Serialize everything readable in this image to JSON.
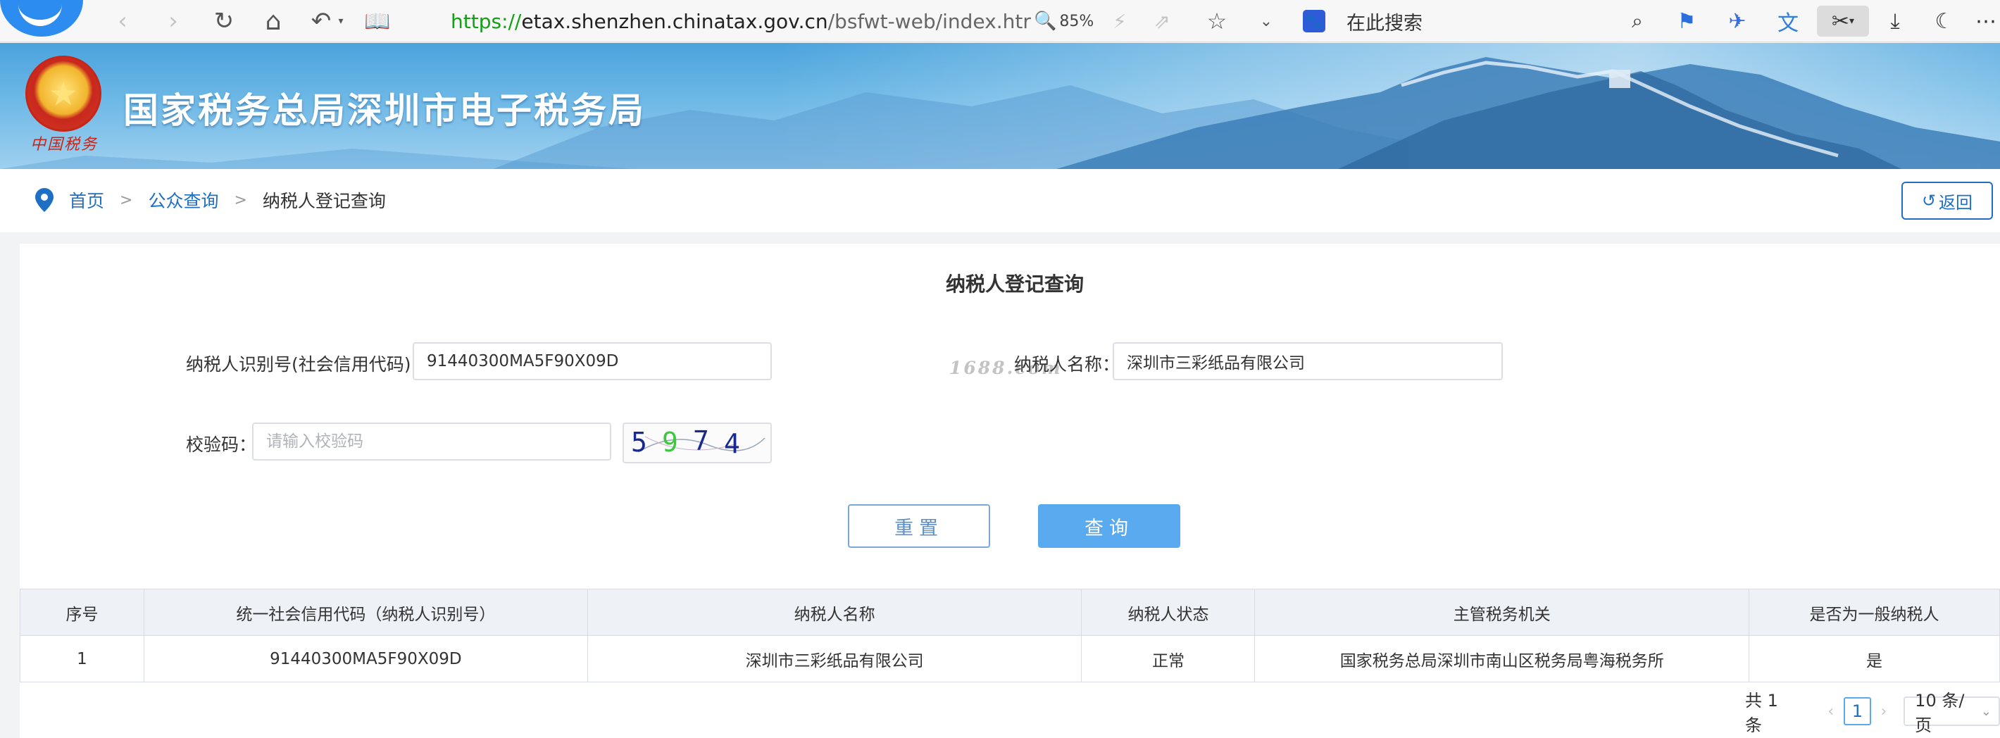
{
  "browser": {
    "url_scheme": "https://",
    "url_host": "etax.shenzhen.chinatax.gov.cn",
    "url_path": "/bsfwt-web/index.htr",
    "zoom": "85%",
    "search_placeholder": "在此搜索"
  },
  "site": {
    "title": "国家税务总局深圳市电子税务局",
    "emblem_script": "中国税务"
  },
  "breadcrumb": {
    "home": "首页",
    "public_query": "公众查询",
    "current": "纳税人登记查询",
    "separator": ">"
  },
  "back_button": "返回",
  "form": {
    "title": "纳税人登记查询",
    "taxpayer_id_label": "纳税人识别号(社会信用代码)：",
    "taxpayer_id_value": "91440300MA5F90X09D",
    "taxpayer_name_label": "纳税人名称：",
    "taxpayer_name_value": "深圳市三彩纸品有限公司",
    "captcha_label": "校验码：",
    "captcha_placeholder": "请输入校验码",
    "captcha_digits": [
      "5",
      "9",
      "7",
      "4"
    ],
    "watermark": "1688.com",
    "reset_label": "重置",
    "query_label": "查询"
  },
  "table": {
    "headers": [
      "序号",
      "统一社会信用代码（纳税人识别号）",
      "纳税人名称",
      "纳税人状态",
      "主管税务机关",
      "是否为一般纳税人"
    ],
    "rows": [
      [
        "1",
        "91440300MA5F90X09D",
        "深圳市三彩纸品有限公司",
        "正常",
        "国家税务总局深圳市南山区税务局粤海税务所",
        "是"
      ]
    ]
  },
  "pagination": {
    "total": "共 1 条",
    "current_page": "1",
    "page_size": "10 条/页"
  },
  "colors": {
    "link_blue": "#1f6fc5",
    "query_button": "#5aaaf0",
    "banner_sky": "#4aa3dc",
    "url_scheme_green": "#12a015"
  }
}
